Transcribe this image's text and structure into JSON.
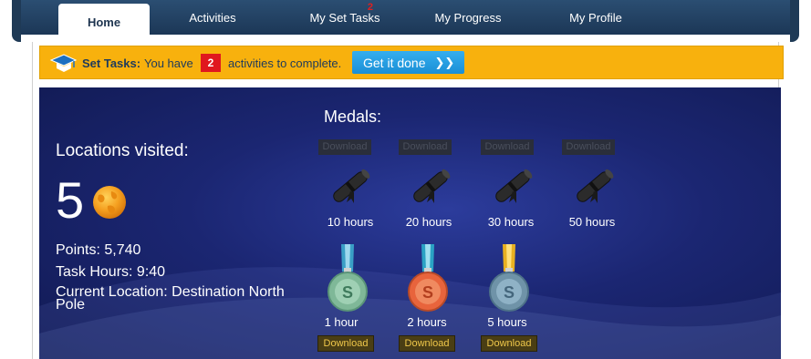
{
  "nav": {
    "tabs": [
      {
        "label": "Home"
      },
      {
        "label": "Activities"
      },
      {
        "label": "My Set Tasks",
        "badge": "2"
      },
      {
        "label": "My Progress"
      },
      {
        "label": "My Profile"
      }
    ]
  },
  "banner": {
    "label": "Set Tasks:",
    "text_before": "You have",
    "count": "2",
    "text_after": "activities to complete.",
    "button_label": "Get it done",
    "button_icon": "double-chevron-right",
    "color": "#f8b10d"
  },
  "locations": {
    "label": "Locations visited:",
    "count": "5"
  },
  "stats": {
    "points": "Points: 5,740",
    "task_hours": "Task Hours: 9:40",
    "current_location": "Current Location: Destination North Pole"
  },
  "medals": {
    "title": "Medals:",
    "certificates": [
      {
        "download": "Download",
        "label": "10 hours"
      },
      {
        "download": "Download",
        "label": "20 hours"
      },
      {
        "download": "Download",
        "label": "30 hours"
      },
      {
        "download": "Download",
        "label": "50 hours"
      }
    ],
    "medals": [
      {
        "label": "1 hour",
        "download": "Download",
        "color": "#7fb898",
        "ribbon": "#3a9fc6"
      },
      {
        "label": "2 hours",
        "download": "Download",
        "color": "#e8643c",
        "ribbon": "#2aa2c4"
      },
      {
        "label": "5 hours",
        "download": "Download",
        "color": "#6f93a8",
        "ribbon": "#e8b020"
      }
    ]
  }
}
